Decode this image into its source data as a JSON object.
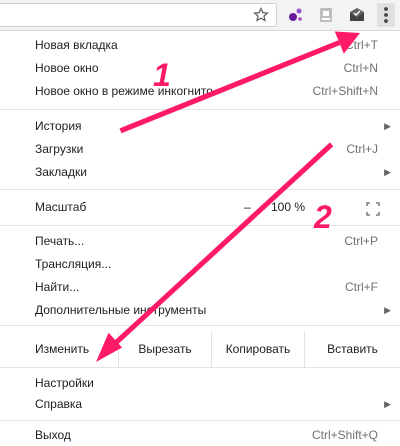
{
  "menu": {
    "new_tab": {
      "label": "Новая вкладка",
      "shortcut": "Ctrl+T"
    },
    "new_window": {
      "label": "Новое окно",
      "shortcut": "Ctrl+N"
    },
    "incognito": {
      "label": "Новое окно в режиме инкогнито",
      "shortcut": "Ctrl+Shift+N"
    },
    "history": {
      "label": "История"
    },
    "downloads": {
      "label": "Загрузки",
      "shortcut": "Ctrl+J"
    },
    "bookmarks": {
      "label": "Закладки"
    },
    "zoom": {
      "label": "Масштаб",
      "minus": "–",
      "value": "100 %",
      "plus": "+"
    },
    "print": {
      "label": "Печать...",
      "shortcut": "Ctrl+P"
    },
    "cast": {
      "label": "Трансляция..."
    },
    "find": {
      "label": "Найти...",
      "shortcut": "Ctrl+F"
    },
    "more_tools": {
      "label": "Дополнительные инструменты"
    },
    "edit": {
      "label": "Изменить",
      "cut": "Вырезать",
      "copy": "Копировать",
      "paste": "Вставить"
    },
    "settings": {
      "label": "Настройки"
    },
    "help": {
      "label": "Справка"
    },
    "exit": {
      "label": "Выход",
      "shortcut": "Ctrl+Shift+Q"
    }
  },
  "annotations": {
    "step1": "1",
    "step2": "2"
  },
  "colors": {
    "arrow": "#ff1a66",
    "menu_bg": "#ffffff",
    "shortcut_text": "#707070"
  },
  "icons": [
    "star-icon",
    "extension-dots-icon",
    "extension-icon",
    "mail-icon",
    "more-vert-icon",
    "fullscreen-icon",
    "submenu-arrow-icon"
  ]
}
